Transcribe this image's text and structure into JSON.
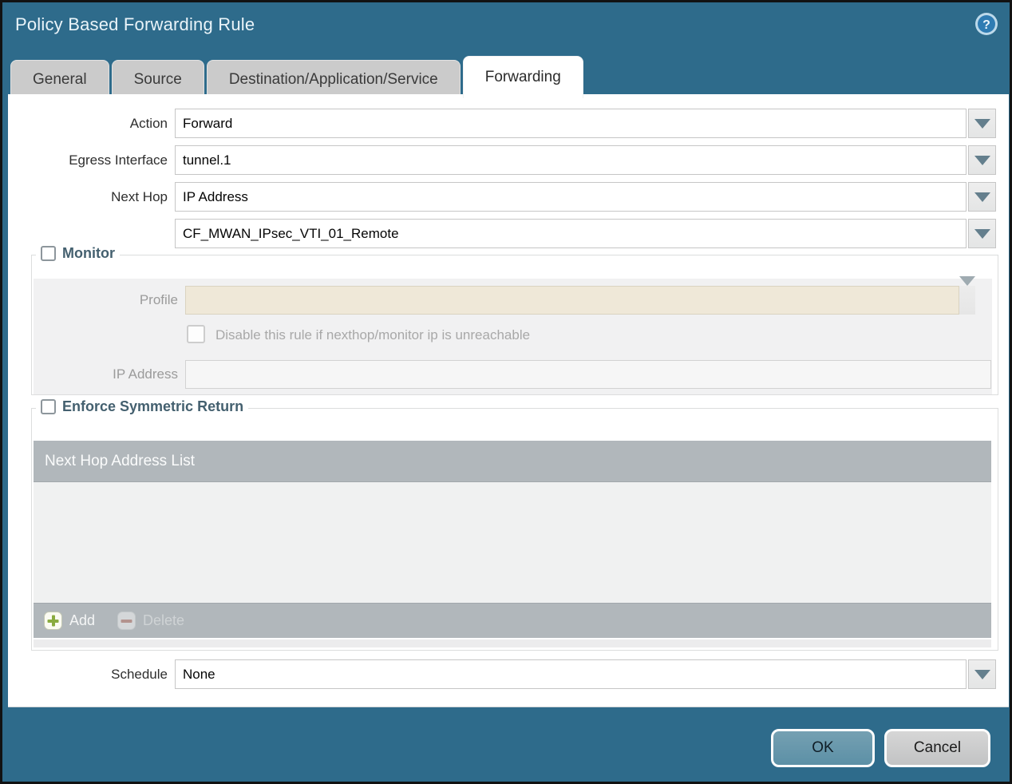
{
  "titlebar": {
    "title": "Policy Based Forwarding Rule"
  },
  "tabs": [
    {
      "label": "General",
      "active": false
    },
    {
      "label": "Source",
      "active": false
    },
    {
      "label": "Destination/Application/Service",
      "active": false
    },
    {
      "label": "Forwarding",
      "active": true
    }
  ],
  "form": {
    "action_label": "Action",
    "action_value": "Forward",
    "egress_label": "Egress Interface",
    "egress_value": "tunnel.1",
    "next_hop_label": "Next Hop",
    "next_hop_type_value": "IP Address",
    "next_hop_address_value": "CF_MWAN_IPsec_VTI_01_Remote",
    "schedule_label": "Schedule",
    "schedule_value": "None"
  },
  "monitor": {
    "title": "Monitor",
    "checked": false,
    "profile_label": "Profile",
    "profile_value": "",
    "disable_checkbox_label": "Disable this rule if nexthop/monitor ip is unreachable",
    "disable_checked": false,
    "ip_address_label": "IP Address",
    "ip_address_value": ""
  },
  "symmetric_return": {
    "title": "Enforce Symmetric Return",
    "checked": false,
    "table_header": "Next Hop Address List",
    "add_label": "Add",
    "delete_label": "Delete"
  },
  "buttons": {
    "ok": "OK",
    "cancel": "Cancel"
  },
  "colors": {
    "titlebar_teal": "#2e6b8b",
    "active_tab": "#ffffff",
    "inactive_tab": "#cbcbcb",
    "table_header_gray": "#b1b7bb",
    "disabled_field_beige": "#efe8d8",
    "ok_button": "#5c90a6",
    "add_icon_green": "#8aab3f",
    "delete_icon_red": "#b5776b"
  }
}
